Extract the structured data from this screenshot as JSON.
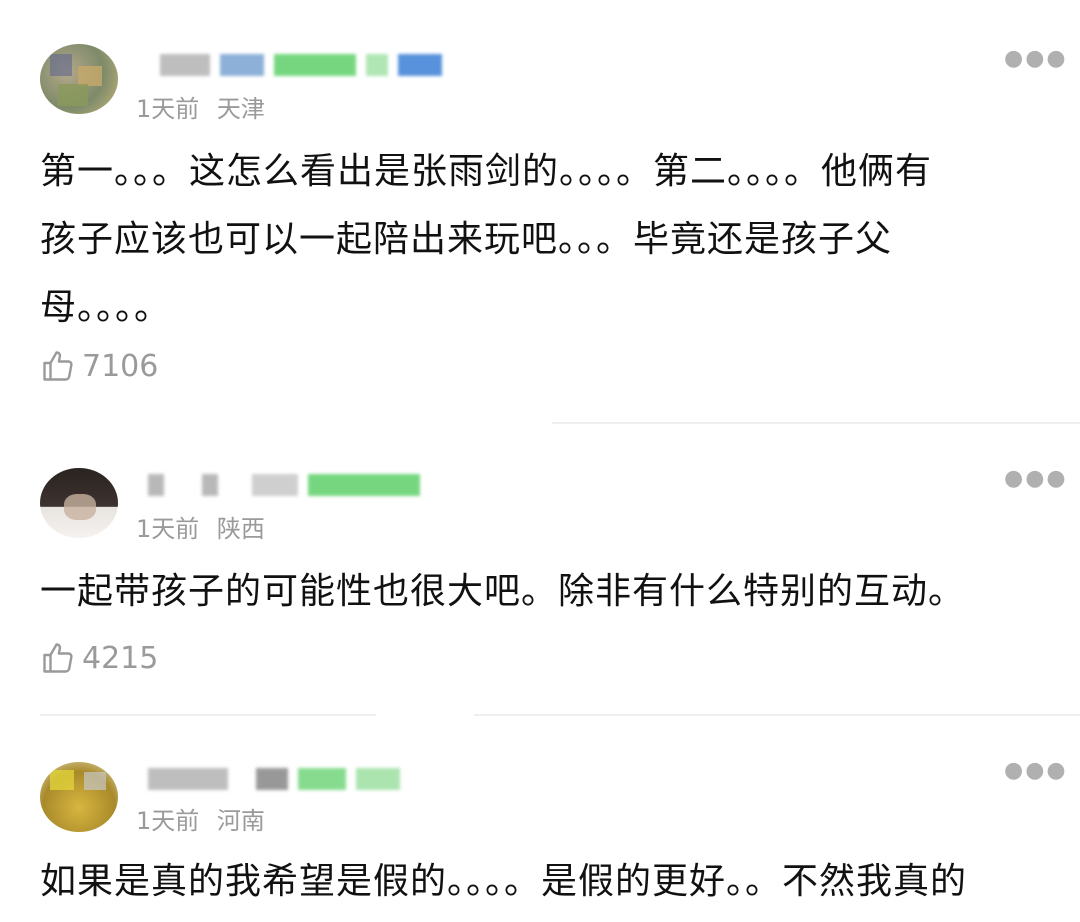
{
  "comments": [
    {
      "time": "1天前",
      "location": "天津",
      "text_lines": [
        "第一。。。这怎么看出是张雨剑的。。。。第二。。。。他俩有",
        "孩子应该也可以一起陪出来玩吧。。。毕竟还是孩子父",
        "母。。。。"
      ],
      "likes": "7106",
      "more_icon": "more-dots-icon",
      "like_icon": "thumbs-up-icon"
    },
    {
      "time": "1天前",
      "location": "陕西",
      "text_lines": [
        "一起带孩子的可能性也很大吧。除非有什么特别的互动。"
      ],
      "likes": "4215",
      "more_icon": "more-dots-icon",
      "like_icon": "thumbs-up-icon"
    },
    {
      "time": "1天前",
      "location": "河南",
      "text_lines": [
        "如果是真的我希望是假的。。。。是假的更好。。不然我真的"
      ],
      "more_icon": "more-dots-icon"
    }
  ],
  "colors": {
    "text": "#111111",
    "meta": "#9a9a9a",
    "badge_green": "#5fd06a",
    "badge_blue": "#3b7fd6",
    "divider": "#eeeeee"
  }
}
